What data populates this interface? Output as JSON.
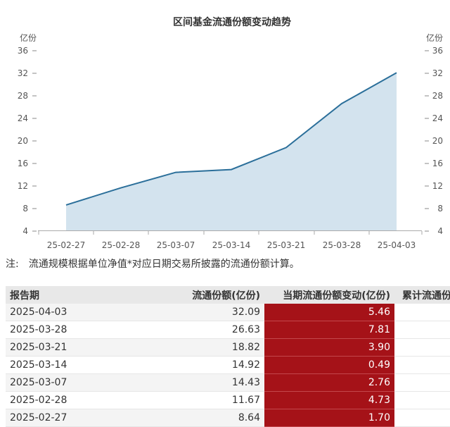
{
  "chart_data": {
    "type": "area",
    "title": "区间基金流通份额变动趋势",
    "y_unit_left": "亿份",
    "y_unit_right": "亿份",
    "ylim": [
      4,
      36
    ],
    "yticks": [
      4,
      8,
      12,
      16,
      20,
      24,
      28,
      32,
      36
    ],
    "grid": false,
    "categories": [
      "25-02-27",
      "25-02-28",
      "25-03-07",
      "25-03-14",
      "25-03-21",
      "25-03-28",
      "25-04-03"
    ],
    "values": [
      8.64,
      11.67,
      14.43,
      14.92,
      18.82,
      26.63,
      32.09
    ],
    "colors": {
      "line": "#2b6f9a",
      "fill": "#d3e3ee"
    }
  },
  "note": {
    "label": "注:",
    "text": "流通规模根据单位净值*对应日期交易所披露的流通份额计算。"
  },
  "table": {
    "headers": [
      "报告期",
      "流通份额(亿份)",
      "当期流通份额变动(亿份)",
      "累计流通份"
    ],
    "rows": [
      [
        "2025-04-03",
        "32.09",
        "5.46"
      ],
      [
        "2025-03-28",
        "26.63",
        "7.81"
      ],
      [
        "2025-03-21",
        "18.82",
        "3.90"
      ],
      [
        "2025-03-14",
        "14.92",
        "0.49"
      ],
      [
        "2025-03-07",
        "14.43",
        "2.76"
      ],
      [
        "2025-02-28",
        "11.67",
        "4.73"
      ],
      [
        "2025-02-27",
        "8.64",
        "1.70"
      ]
    ],
    "change_color": "#a51218"
  }
}
